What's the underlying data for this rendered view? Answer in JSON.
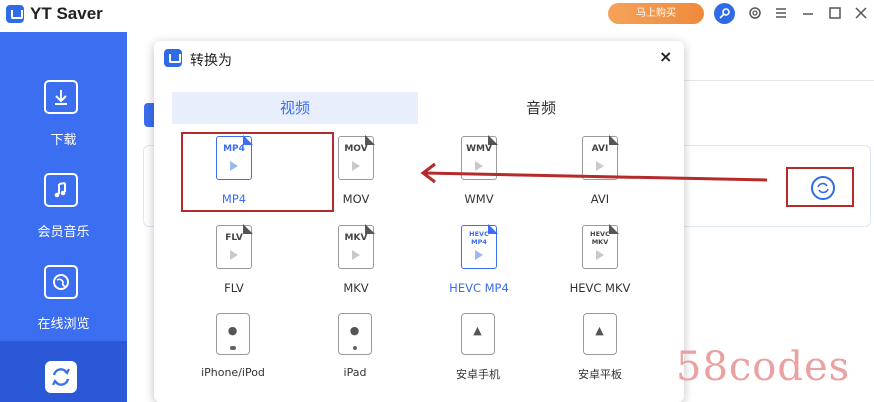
{
  "app": {
    "title": "YT Saver",
    "buy_label": "马上购买"
  },
  "sidebar": {
    "items": [
      {
        "label": "下载",
        "icon": "download-icon"
      },
      {
        "label": "会员音乐",
        "icon": "music-icon"
      },
      {
        "label": "在线浏览",
        "icon": "browser-icon"
      }
    ],
    "active_icon": "convert-icon"
  },
  "dialog": {
    "title": "转换为",
    "close": "×",
    "tabs": {
      "video": "视频",
      "audio": "音频"
    },
    "video_formats": [
      {
        "file": "MP4",
        "name": "MP4"
      },
      {
        "file": "MOV",
        "name": "MOV"
      },
      {
        "file": "WMV",
        "name": "WMV"
      },
      {
        "file": "AVI",
        "name": "AVI"
      },
      {
        "file": "FLV",
        "name": "FLV"
      },
      {
        "file": "MKV",
        "name": "MKV"
      },
      {
        "file": "HEVC MP4",
        "name": "HEVC MP4"
      },
      {
        "file": "HEVC MKV",
        "name": "HEVC MKV"
      }
    ],
    "devices": [
      {
        "name": "iPhone/iPod",
        "icon": "apple-icon"
      },
      {
        "name": "iPad",
        "icon": "apple-icon"
      },
      {
        "name": "安卓手机",
        "icon": "android-icon"
      },
      {
        "name": "安卓平板",
        "icon": "android-icon"
      }
    ]
  },
  "watermark": "58codes",
  "colors": {
    "accent": "#3b6ef0",
    "annotation": "#b52a2a",
    "buy": "#f08a3c"
  }
}
